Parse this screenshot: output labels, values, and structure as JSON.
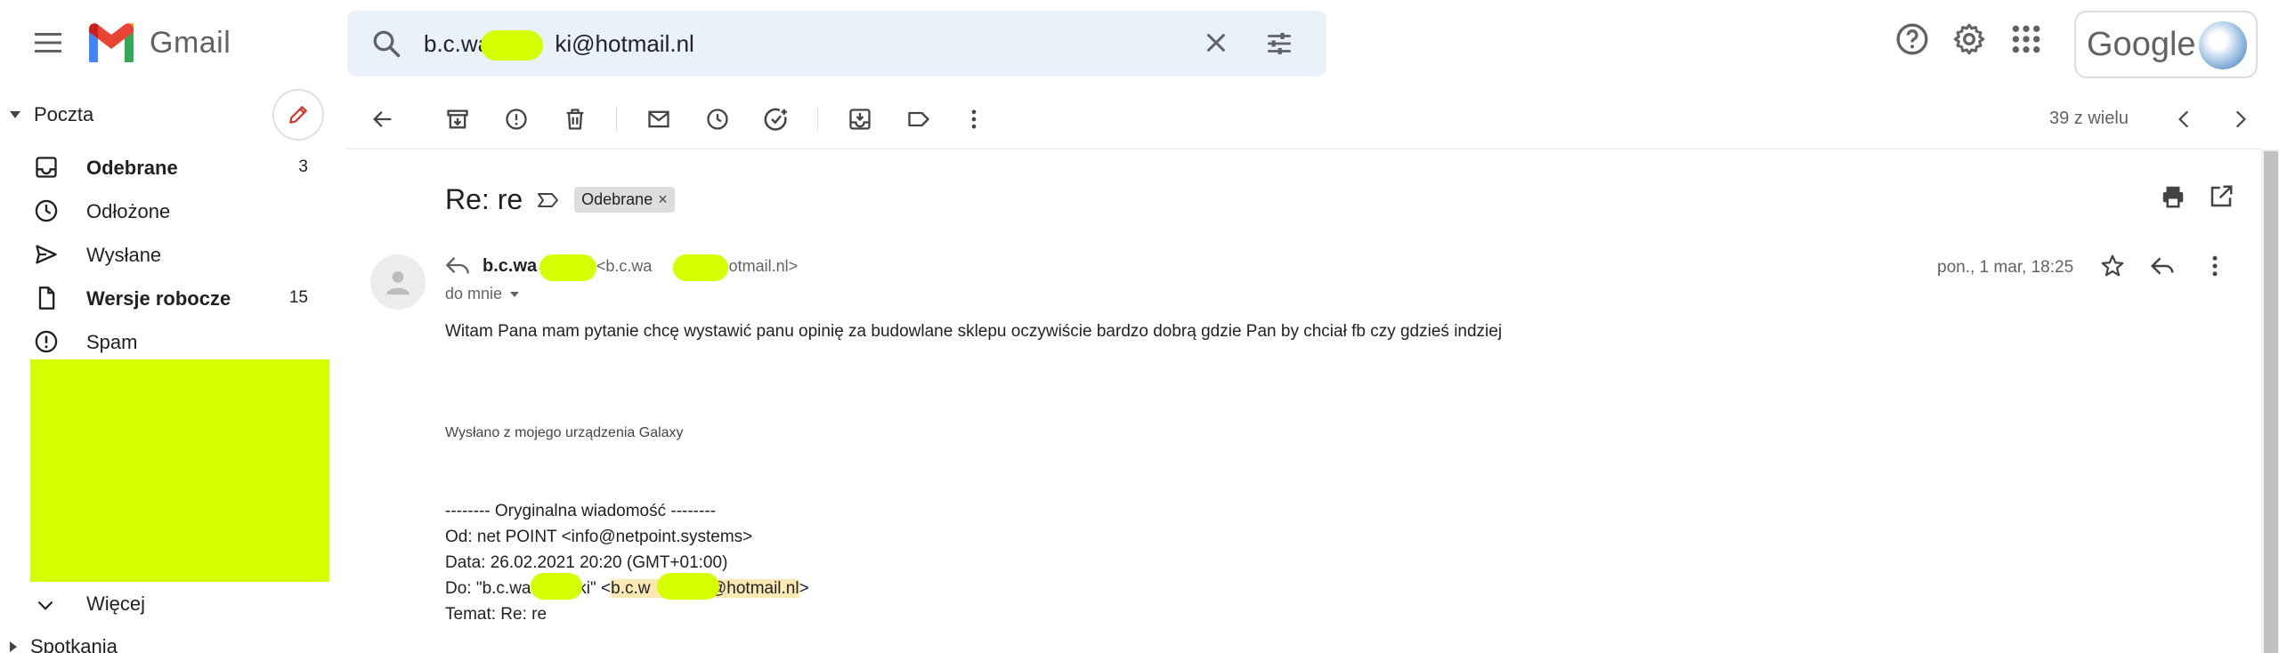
{
  "header": {
    "app_name": "Gmail",
    "search": {
      "value": "b.c.wa          ki@hotmail.nl"
    },
    "account_brand": "Google"
  },
  "sidebar": {
    "section": "Poczta",
    "items": [
      {
        "label": "Odebrane",
        "count": "3",
        "bold": true,
        "icon": "inbox-icon"
      },
      {
        "label": "Odłożone",
        "count": "",
        "bold": false,
        "icon": "clock-icon"
      },
      {
        "label": "Wysłane",
        "count": "",
        "bold": false,
        "icon": "send-icon"
      },
      {
        "label": "Wersje robocze",
        "count": "15",
        "bold": true,
        "icon": "draft-icon"
      },
      {
        "label": "Spam",
        "count": "",
        "bold": false,
        "icon": "spam-icon"
      }
    ],
    "more_label": "Więcej",
    "meetings_label": "Spotkania"
  },
  "toolbar": {
    "pager": "39 z wielu"
  },
  "message": {
    "subject": "Re: re",
    "label_chip": "Odebrane",
    "sender_name": "b.c.wa        ki",
    "sender_email": "<b.c.wa         ki@hotmail.nl>",
    "to_line": "do mnie",
    "date": "pon., 1 mar, 18:25",
    "body": "Witam Pana mam pytanie chcę wystawić panu opinię za budowlane sklepu oczywiście bardzo dobrą gdzie Pan by chciał fb czy gdzieś indziej",
    "signature": "Wysłano z mojego urządzenia Galaxy",
    "quoted": {
      "header": "-------- Oryginalna wiadomość --------",
      "from": "Od: net POINT <info@netpoint.systems>",
      "date": "Data: 26.02.2021 20:20 (GMT+01:00)",
      "to_prefix": "Do: \"b.c.wa          ki\" <",
      "to_email": "b.c.w          ki@hotmail.nl",
      "to_suffix": ">",
      "subject": "Temat: Re: re"
    }
  },
  "colors": {
    "redaction": "#d4ff00",
    "search_bg": "#eaf1fb",
    "highlight": "#fce8b2"
  }
}
